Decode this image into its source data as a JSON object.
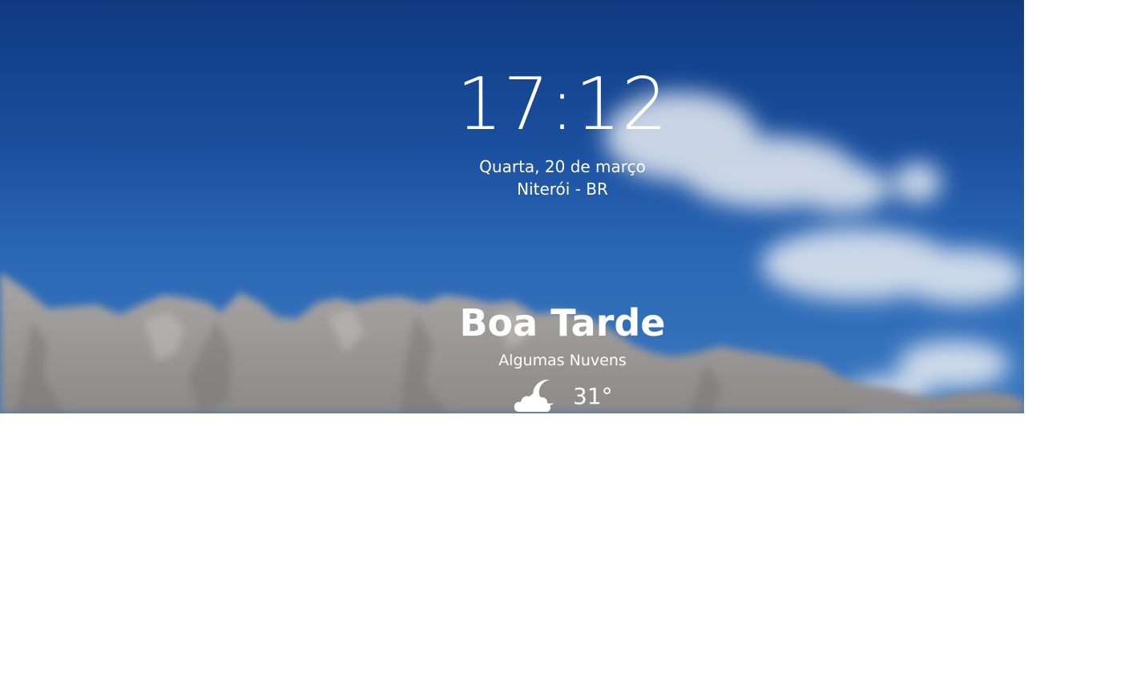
{
  "lockscreen": {
    "time": "17:12",
    "date": "Quarta, 20 de março",
    "location": "Niterói - BR",
    "greeting": "Boa Tarde",
    "weather": {
      "condition": "Algumas Nuvens",
      "temperature": "31°",
      "icon": "cloud-moon-icon"
    }
  }
}
